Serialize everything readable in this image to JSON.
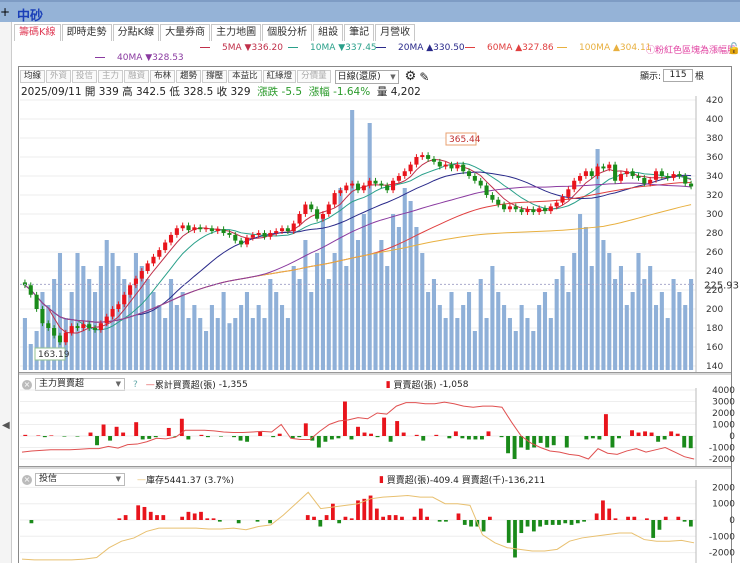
{
  "window": {
    "title": "中砂",
    "add_icon": "plus-icon"
  },
  "tabs": [
    {
      "label": "籌碼K線",
      "active": true
    },
    {
      "label": "即時走勢"
    },
    {
      "label": "分點K線"
    },
    {
      "label": "大量券商"
    },
    {
      "label": "主力地圖"
    },
    {
      "label": "個股分析"
    },
    {
      "label": "組設"
    },
    {
      "label": "筆記"
    },
    {
      "label": "月營收"
    }
  ],
  "ma_legend": [
    {
      "label": "5MA",
      "arrow": "▼",
      "value": "336.20",
      "color": "#c0304a"
    },
    {
      "label": "10MA",
      "arrow": "▼",
      "value": "337.45",
      "color": "#2aa08a"
    },
    {
      "label": "20MA",
      "arrow": "▲",
      "value": "330.50",
      "color": "#2a2a8a"
    },
    {
      "label": "60MA",
      "arrow": "▲",
      "value": "327.86",
      "color": "#e04040"
    },
    {
      "label": "100MA",
      "arrow": "▲",
      "value": "304.11",
      "color": "#e8b040"
    },
    {
      "label": "40MA",
      "arrow": "▼",
      "value": "328.53",
      "color": "#8a3aa0"
    }
  ],
  "notice": "ⓘ粉紅色區塊為漲幅股",
  "toolbar": {
    "buttons": [
      {
        "label": "均線"
      },
      {
        "label": "外資",
        "dim": true
      },
      {
        "label": "投信",
        "dim": true
      },
      {
        "label": "主力",
        "dim": true
      },
      {
        "label": "融資",
        "dim": true
      },
      {
        "label": "布林"
      },
      {
        "label": "趨勢"
      },
      {
        "label": "撐壓"
      },
      {
        "label": "本益比"
      },
      {
        "label": "紅綠燈"
      },
      {
        "label": "分價量",
        "dim": true
      }
    ],
    "period": "日線(還原)",
    "show_label": "顯示:",
    "show_count": "115",
    "show_unit": "根"
  },
  "info": {
    "date": "2025/09/11",
    "open_label": "開",
    "open": "339",
    "high_label": "高",
    "high": "342.5",
    "low_label": "低",
    "low": "328.5",
    "close_label": "收",
    "close": "329",
    "change_label": "漲跌",
    "change": "-5.5",
    "pct_label": "漲幅",
    "pct": "-1.64%",
    "vol_label": "量",
    "vol": "4,202"
  },
  "colors": {
    "up": "#e8141c",
    "down": "#1a8a1a",
    "volume": "#8fb0d8",
    "cum_line": "#e05050",
    "sec_line": "#e8c070"
  },
  "chart_data": [
    {
      "type": "candlestick",
      "yticks": [
        140,
        160,
        180,
        200,
        220,
        240,
        260,
        280,
        300,
        320,
        340,
        360,
        380,
        400,
        420
      ],
      "ylim": [
        130,
        425
      ],
      "max_label": "365.44",
      "min_label": "163.19",
      "ref_price_label": "225.93",
      "closes": [
        225,
        215,
        200,
        185,
        180,
        172,
        165,
        175,
        182,
        180,
        184,
        180,
        178,
        185,
        192,
        200,
        205,
        215,
        225,
        232,
        240,
        248,
        255,
        262,
        270,
        278,
        285,
        288,
        283,
        286,
        284,
        285,
        282,
        284,
        280,
        278,
        272,
        268,
        275,
        278,
        280,
        276,
        280,
        282,
        285,
        282,
        290,
        300,
        310,
        305,
        295,
        300,
        310,
        322,
        325,
        330,
        332,
        325,
        330,
        335,
        332,
        330,
        325,
        335,
        340,
        345,
        352,
        360,
        362,
        358,
        355,
        350,
        352,
        348,
        352,
        345,
        340,
        335,
        330,
        320,
        315,
        310,
        305,
        308,
        305,
        302,
        305,
        302,
        306,
        303,
        308,
        312,
        318,
        326,
        335,
        340,
        345,
        340,
        350,
        348,
        352,
        335,
        342,
        345,
        340,
        338,
        332,
        336,
        345,
        340,
        338,
        342,
        340,
        332,
        329
      ],
      "volumes": [
        20,
        10,
        15,
        30,
        25,
        35,
        45,
        20,
        30,
        45,
        40,
        35,
        30,
        40,
        50,
        45,
        40,
        35,
        30,
        45,
        40,
        35,
        30,
        25,
        20,
        35,
        25,
        30,
        20,
        25,
        20,
        15,
        25,
        20,
        30,
        18,
        20,
        25,
        30,
        20,
        25,
        20,
        35,
        30,
        25,
        20,
        40,
        35,
        50,
        30,
        45,
        60,
        35,
        45,
        70,
        40,
        100,
        50,
        60,
        95,
        45,
        50,
        40,
        60,
        55,
        70,
        65,
        55,
        45,
        30,
        35,
        25,
        20,
        30,
        20,
        25,
        30,
        15,
        35,
        20,
        40,
        30,
        25,
        20,
        15,
        25,
        20,
        15,
        25,
        30,
        20,
        35,
        40,
        30,
        45,
        60,
        55,
        40,
        85,
        50,
        45,
        35,
        40,
        25,
        30,
        45,
        35,
        40,
        25,
        30,
        20,
        35,
        30,
        25,
        35
      ]
    },
    {
      "type": "bar+line",
      "name": "主力買賣超",
      "line_label": "累計買賣超(張)",
      "line_value": "-1,355",
      "bar_label": "買賣超(張)",
      "bar_value": "-1,058",
      "yticks": [
        -2000,
        -1000,
        0,
        1000,
        2000,
        3000,
        4000
      ],
      "bars": [
        100,
        0,
        50,
        -100,
        50,
        0,
        -50,
        0,
        -50,
        0,
        300,
        -800,
        1000,
        -400,
        800,
        300,
        0,
        1200,
        -300,
        -250,
        -100,
        0,
        700,
        -50,
        1500,
        -300,
        0,
        100,
        -100,
        0,
        -50,
        0,
        -100,
        -400,
        -500,
        0,
        400,
        0,
        -100,
        200,
        0,
        -200,
        -100,
        1100,
        -400,
        -1000,
        -500,
        -300,
        -200,
        3000,
        -300,
        800,
        300,
        200,
        -100,
        1600,
        -500,
        1300,
        300,
        0,
        100,
        -400,
        0,
        100,
        0,
        -200,
        400,
        -200,
        -300,
        -300,
        -300,
        400,
        0,
        -100,
        -1500,
        -2000,
        -1000,
        -1200,
        -1000,
        -600,
        -1000,
        -800,
        0,
        -1000,
        0,
        0,
        -300,
        -200,
        -300,
        1900,
        -1000,
        -200,
        0,
        500,
        300,
        400,
        300,
        -500,
        -300,
        400,
        200,
        -1000,
        -1058
      ],
      "line": [
        -1400,
        -1300,
        -1250,
        -1200,
        -1200,
        -1200,
        -1150,
        -1100,
        -1100,
        -900,
        -1050,
        -750,
        -700,
        -500,
        -200,
        -250,
        -100,
        500,
        500,
        500,
        450,
        350,
        300,
        300,
        350,
        400,
        350,
        1000,
        -200,
        -300,
        -300,
        400,
        1000,
        1300,
        1400,
        1600,
        1500,
        2000,
        1900,
        2600,
        2900,
        2900,
        2800,
        2800,
        2950,
        2800,
        2600,
        2500,
        2600,
        2600,
        2500,
        1200,
        0,
        -600,
        -1000,
        -1300,
        -1400,
        -1600,
        -1700,
        -2000,
        -1100,
        -1500,
        -1600,
        -1300,
        -1100,
        -1400,
        -1200,
        -1000,
        -1400,
        -1800,
        -2000
      ]
    },
    {
      "type": "bar+line",
      "name": "投信",
      "line_label": "庫存5441.37 (3.7%)",
      "bar_label": "買賣超(張)-409.4 買賣超(千)-136,211",
      "yticks": [
        -2000,
        -1000,
        0,
        1000,
        2000
      ],
      "bars": [
        0,
        -200,
        0,
        0,
        0,
        0,
        0,
        0,
        0,
        0,
        0,
        0,
        0,
        0,
        0,
        100,
        300,
        0,
        900,
        800,
        500,
        300,
        300,
        0,
        0,
        200,
        500,
        400,
        500,
        100,
        100,
        -100,
        0,
        0,
        -200,
        0,
        0,
        -100,
        0,
        -200,
        0,
        0,
        0,
        0,
        0,
        300,
        200,
        -400,
        300,
        1000,
        -200,
        200,
        100,
        1200,
        1300,
        1500,
        700,
        200,
        300,
        300,
        200,
        0,
        200,
        700,
        200,
        0,
        -100,
        -100,
        0,
        400,
        -300,
        -400,
        -400,
        -700,
        200,
        0,
        0,
        -1400,
        -2300,
        -800,
        -400,
        -700,
        -400,
        -300,
        -300,
        -300,
        -200,
        -300,
        -200,
        -100,
        0,
        400,
        1200,
        700,
        100,
        0,
        200,
        200,
        0,
        100,
        -1100,
        -600,
        200,
        0,
        200,
        -100,
        -400
      ],
      "line": [
        -2400,
        -2450,
        -2450,
        -2450,
        -2450,
        -2400,
        -2300,
        -1700,
        -1300,
        -1100,
        -700,
        -500,
        -500,
        -500,
        -500,
        -550,
        -550,
        -500,
        -600,
        -400,
        -300,
        300,
        1000,
        1700,
        700,
        800,
        900,
        1000,
        1300,
        1400,
        1450,
        1500,
        1400,
        1400,
        1000,
        1000,
        900,
        -900,
        -1400,
        -1700,
        -1800,
        -1900,
        -1900,
        -1800,
        -1300,
        -1100,
        -1000,
        -900,
        -800,
        -800,
        -1200,
        -1300,
        -1300,
        -1250,
        -1400
      ]
    }
  ]
}
